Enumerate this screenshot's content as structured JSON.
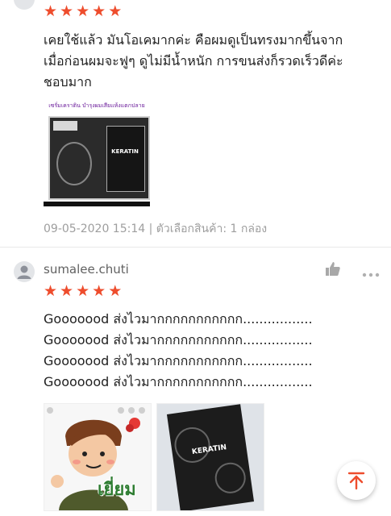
{
  "review1": {
    "rating": 5,
    "text_lines": [
      "เคยใช้แล้ว มันโอเคมากค่ะ คือผมดูเป็นทรงมากขึ้นจาก",
      "เมื่อก่อนผมจะฟูๆ ดูไม่มีน้ำหนัก การขนส่งก็รวดเร็วดีค่ะ",
      "ชอบมาก"
    ],
    "image_banner_text": "เซรั่มเคราติน บำรุงผมเสียแห้งแตกปลาย",
    "product_label": "KERATIN",
    "meta": "09-05-2020 15:14 | ตัวเลือกสินค้า: 1 กล่อง"
  },
  "review2": {
    "username": "sumalee.chuti",
    "rating": 5,
    "text_lines": [
      "Gooooood ส่งไวมากกกกกกกกกกก.................",
      "Gooooood ส่งไวมากกกกกกกกกกก.................",
      "Gooooood ส่งไวมากกกกกกกกกกก.................",
      "Gooooood ส่งไวมากกกกกกกกกกก................."
    ],
    "sticker_text": "เยี่ยม",
    "product_label": "KERATIN"
  },
  "icons": {
    "star": "star-icon",
    "like": "thumbs-up-icon",
    "more": "more-dots-icon",
    "avatar": "user-avatar-icon",
    "scroll_top": "arrow-up-to-top-icon"
  },
  "colors": {
    "star": "#ee4d2d",
    "accent": "#ee4d2d",
    "meta_text": "#9e9e9e"
  }
}
